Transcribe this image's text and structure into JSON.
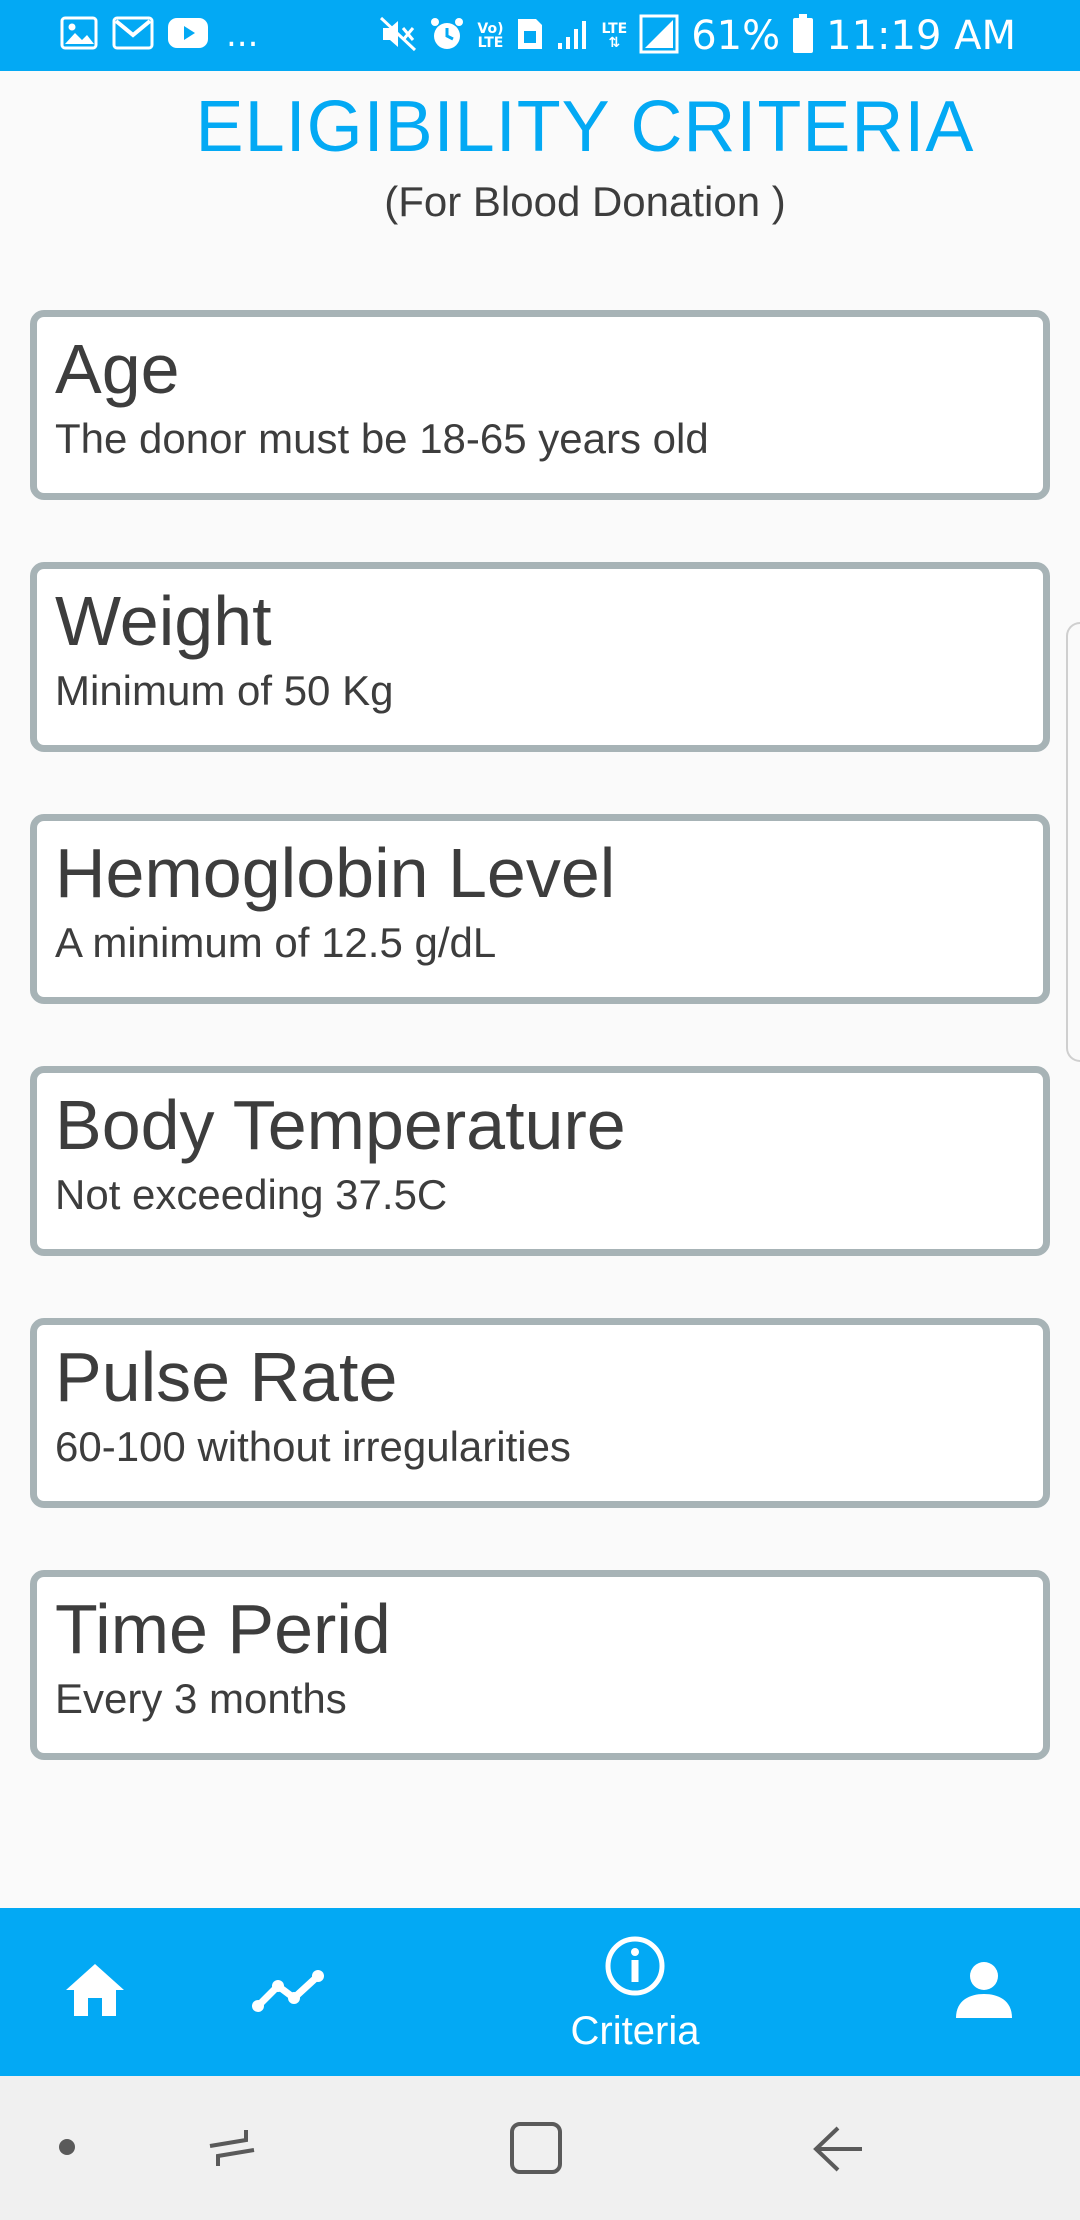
{
  "status_bar": {
    "more_indicator": "...",
    "battery": "61%",
    "time": "11:19 AM",
    "volte_label_top": "Vo)",
    "volte_label_bottom": "LTE",
    "lte_label": "LTE",
    "icons": [
      "gallery-icon",
      "gmail-icon",
      "youtube-icon",
      "mute-icon",
      "alarm-icon",
      "volte-icon",
      "sim-icon",
      "signal-icon",
      "lte-signal-icon",
      "battery-icon"
    ]
  },
  "header": {
    "title": "ELIGIBILITY CRITERIA",
    "subtitle": "(For Blood Donation )"
  },
  "criteria": [
    {
      "title": "Age",
      "description": "The donor must be 18-65 years old"
    },
    {
      "title": "Weight",
      "description": "Minimum of 50 Kg"
    },
    {
      "title": "Hemoglobin Level",
      "description": "A minimum of 12.5 g/dL"
    },
    {
      "title": "Body Temperature",
      "description": "Not exceeding 37.5C"
    },
    {
      "title": "Pulse Rate",
      "description": "60-100 without irregularities"
    },
    {
      "title": "Time Perid",
      "description": "Every 3 months"
    }
  ],
  "bottom_nav": {
    "items": [
      {
        "icon": "home-icon"
      },
      {
        "icon": "trend-icon"
      },
      {
        "icon": "info-icon",
        "label": "Criteria",
        "active": true
      },
      {
        "icon": "person-icon"
      }
    ]
  },
  "colors": {
    "accent": "#03a9f4",
    "card_border": "#a7b3b6",
    "text": "#3d3d3d",
    "background": "#fafafa"
  }
}
